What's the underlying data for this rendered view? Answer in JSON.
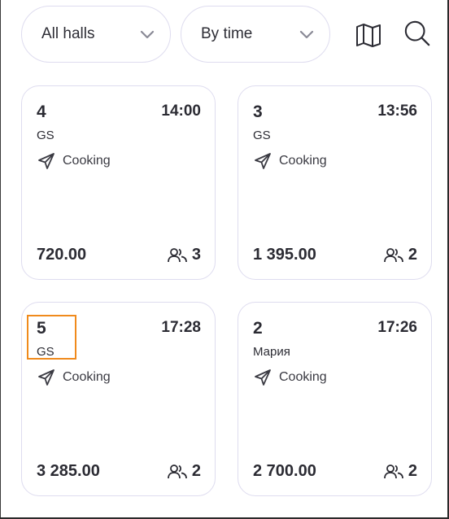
{
  "filters": {
    "halls_label": "All halls",
    "time_label": "By time"
  },
  "toolbar": {
    "map_icon": "map-icon",
    "search_icon": "search-icon"
  },
  "accent": "#f08a1c",
  "orders": [
    {
      "table": "4",
      "time": "14:00",
      "name": "GS",
      "status": "Cooking",
      "amount": "720.00",
      "guests": "3"
    },
    {
      "table": "3",
      "time": "13:56",
      "name": "GS",
      "status": "Cooking",
      "amount": "1 395.00",
      "guests": "2"
    },
    {
      "table": "5",
      "time": "17:28",
      "name": "GS",
      "status": "Cooking",
      "amount": "3 285.00",
      "guests": "2"
    },
    {
      "table": "2",
      "time": "17:26",
      "name": "Мария",
      "status": "Cooking",
      "amount": "2 700.00",
      "guests": "2"
    }
  ]
}
